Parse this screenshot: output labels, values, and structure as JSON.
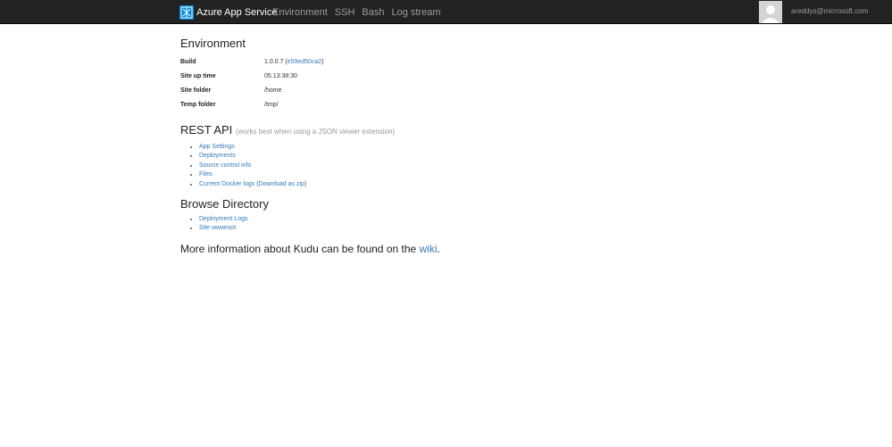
{
  "navbar": {
    "brand": "Azure App Service",
    "links": [
      "Environment",
      "SSH",
      "Bash",
      "Log stream"
    ],
    "user_email": "areddys@microsoft.com",
    "colors": {
      "bar": "#222222",
      "link": "#9d9d9d",
      "logo": "#0089d6"
    }
  },
  "environment": {
    "title": "Environment",
    "rows": {
      "build": {
        "label": "Build",
        "value": "1.0.0.7",
        "paren_open": " (",
        "commit": "e59ed50ca2",
        "paren_close": ")"
      },
      "uptime": {
        "label": "Site up time",
        "value": "05.13:38:30"
      },
      "site_folder": {
        "label": "Site folder",
        "value": "/home"
      },
      "temp_folder": {
        "label": "Temp folder",
        "value": "/tmp/"
      }
    }
  },
  "rest_api": {
    "title": "REST API",
    "note": "(works best when using a JSON viewer extension)",
    "links": {
      "app_settings": "App Settings",
      "deployments": "Deployments",
      "source_control": "Source control info",
      "files": "Files",
      "docker_logs": "Current Docker logs",
      "docker_paren_open": " (",
      "download_zip": "Download as zip",
      "docker_paren_close": ")"
    }
  },
  "browse": {
    "title": "Browse Directory",
    "links": {
      "deployment_logs": "Deployment Logs",
      "wwwroot": "Site wwwroot"
    }
  },
  "more_info": {
    "text": "More information about Kudu can be found on the ",
    "link": "wiki",
    "suffix": "."
  }
}
